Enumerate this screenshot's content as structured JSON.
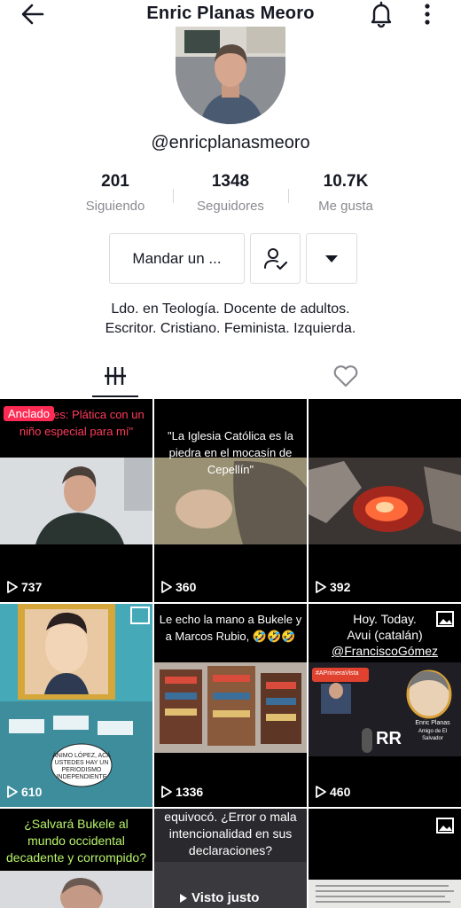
{
  "header": {
    "title": "Enric Planas Meoro",
    "back_icon": "arrow-left-icon",
    "bell_icon": "bell-icon",
    "more_icon": "more-vertical-icon"
  },
  "profile": {
    "handle": "@enricplanasmeoro",
    "stats": [
      {
        "num": "201",
        "label": "Siguiendo"
      },
      {
        "num": "1348",
        "label": "Seguidores"
      },
      {
        "num": "10.7K",
        "label": "Me gusta"
      }
    ],
    "message_button": "Mandar un ...",
    "bio_line1": "Ldo. en Teología. Docente de adultos.",
    "bio_line2": "Escritor. Cristiano. Feminista. Izquierda."
  },
  "tabs": {
    "videos_icon": "grid-bars-icon",
    "liked_icon": "heart-icon"
  },
  "videos": [
    {
      "pinned": "Anclado",
      "caption": "\" Los reyes: Plática con un niño especial para mí\"",
      "views": "737"
    },
    {
      "caption": "\"La Iglesia Católica es la piedra en el mocasín de Cepellín\"",
      "views": "360"
    },
    {
      "caption": "",
      "views": "392"
    },
    {
      "caption": "",
      "views": "610",
      "comic_text": "ÁNIMO LÓPEZ, ACÁ USTEDES HAY UN PERIODISMO INDEPENDIENTE"
    },
    {
      "caption": "Le echo la mano a Bukele y a Marcos Rubio, 🤣🤣🤣",
      "views": "1336"
    },
    {
      "caption_line1": "Hoy. Today.",
      "caption_line2": "Avui (catalán)",
      "caption_line3": "@FranciscoGómez",
      "views": "460",
      "banner": "#APrimeraVista",
      "logo": "RR",
      "person_name": "Enric Planas",
      "person_sub": "Amigo de El Salvador"
    },
    {
      "caption": "¿Salvará Bukele al mundo occidental decadente y corrompido?"
    },
    {
      "caption": "equivocó. ¿Error o mala intencionalidad en sus declaraciones?",
      "overlay": "Visto justo"
    },
    {
      "caption": ""
    }
  ],
  "colors": {
    "accent": "#fe2c55",
    "green_caption": "#b8f36b",
    "red_caption": "#ff3b5c",
    "text": "#161823",
    "muted": "#8a8b91"
  }
}
